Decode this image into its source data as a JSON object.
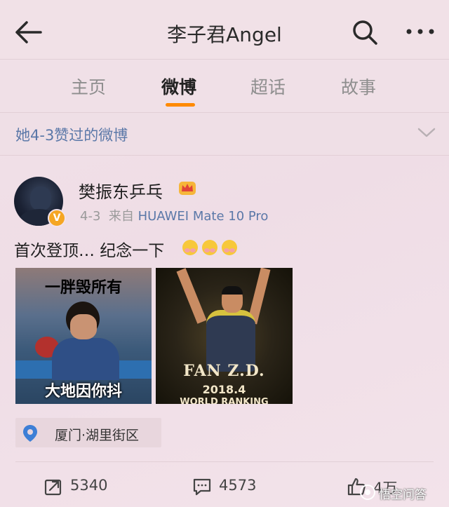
{
  "header": {
    "title": "李子君Angel",
    "back_icon": "back-arrow-icon",
    "search_icon": "search-icon",
    "more_icon": "more-dots-icon"
  },
  "tabs": [
    {
      "label": "主页",
      "active": false
    },
    {
      "label": "微博",
      "active": true
    },
    {
      "label": "超话",
      "active": false
    },
    {
      "label": "故事",
      "active": false
    }
  ],
  "liked_section": {
    "text": "她4-3赞过的微博",
    "chevron_icon": "chevron-down-icon"
  },
  "post": {
    "author": "樊振东乒乓",
    "date": "4-3",
    "source_prefix": "来自",
    "source": "HUAWEI Mate 10 Pro",
    "verified_badge": "V",
    "text": "首次登顶… 纪念一下",
    "image1": {
      "caption_top": "一胖毁所有",
      "caption_bottom": "大地因你抖"
    },
    "image2": {
      "line1": "FAN Z.D.",
      "line2": "2018.4",
      "line3": "WORLD RANKING"
    },
    "location": "厦门·湖里街区",
    "actions": {
      "repost": "5340",
      "comment": "4573",
      "like": "4万"
    }
  },
  "watermark": {
    "text": "悟空问答"
  },
  "colors": {
    "accent_orange": "#ff8a00",
    "link_blue": "#5b78a8",
    "verified_gold": "#f5a623"
  }
}
